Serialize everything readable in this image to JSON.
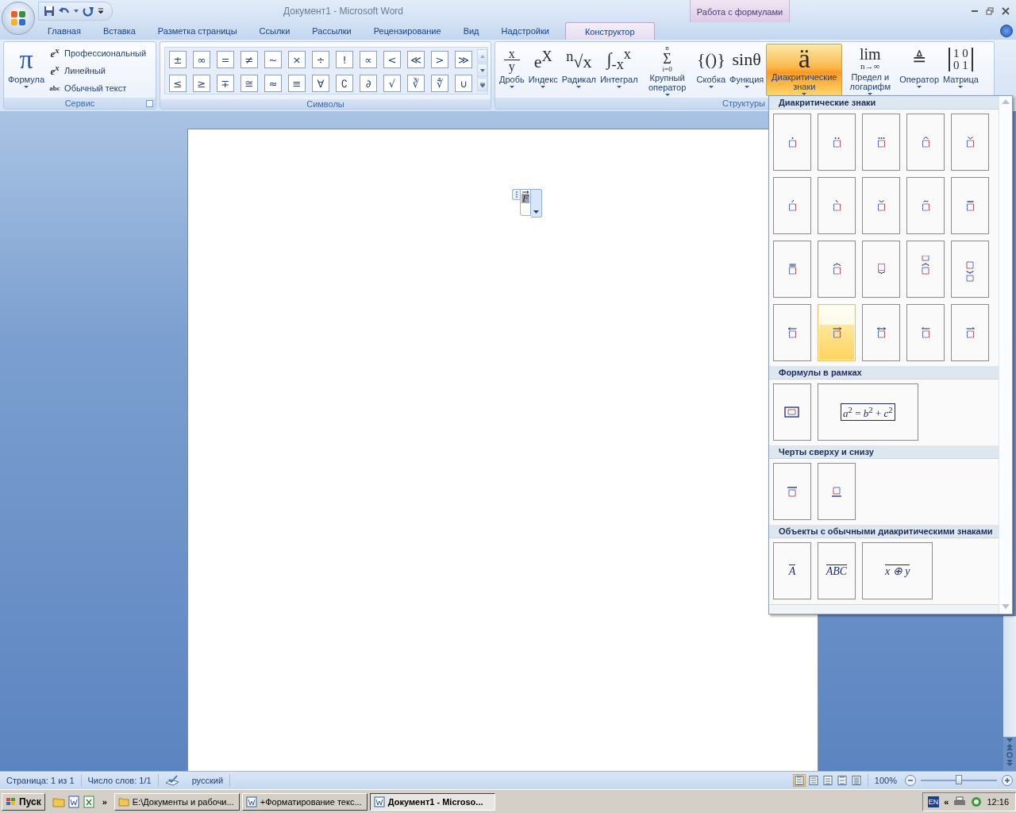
{
  "window": {
    "title": "Документ1 - Microsoft Word",
    "context_title": "Работа с формулами"
  },
  "tabs": [
    {
      "label": "Главная",
      "selected": false
    },
    {
      "label": "Вставка",
      "selected": false
    },
    {
      "label": "Разметка страницы",
      "selected": false
    },
    {
      "label": "Ссылки",
      "selected": false
    },
    {
      "label": "Рассылки",
      "selected": false
    },
    {
      "label": "Рецензирование",
      "selected": false
    },
    {
      "label": "Вид",
      "selected": false
    },
    {
      "label": "Надстройки",
      "selected": false
    },
    {
      "label": "Конструктор",
      "selected": true
    }
  ],
  "service_group": {
    "label": "Сервис",
    "formula_button": {
      "glyph": "π",
      "label": "Формула"
    },
    "options": [
      {
        "glyph": "e$^{x}$",
        "label": "Профессиональный"
      },
      {
        "glyph": "e$^{x}$",
        "label": "Линейный"
      },
      {
        "glyph": "abc",
        "label": "Обычный текст"
      }
    ]
  },
  "symbols_group": {
    "label": "Символы",
    "symbols": [
      "±",
      "∞",
      "=",
      "≠",
      "~",
      "×",
      "÷",
      "!",
      "∝",
      "<",
      "≪",
      ">",
      "≫",
      "≤",
      "≥",
      "∓",
      "≅",
      "≈",
      "≡",
      "∀",
      "∁",
      "∂",
      "√",
      "∛",
      "∜",
      "∪"
    ]
  },
  "structures_group": {
    "label": "Структуры",
    "items": [
      {
        "kind": "fraction",
        "glyph": [
          "x",
          "y"
        ],
        "label": "Дробь",
        "selected": false
      },
      {
        "kind": "inline",
        "glyph": [
          "e$^{X}$"
        ],
        "label": "Индекс",
        "selected": false
      },
      {
        "kind": "inline",
        "glyph": [
          "$^{n}$√x"
        ],
        "label": "Радикал",
        "selected": false
      },
      {
        "kind": "inline",
        "glyph": [
          "∫$_{-x}$$^{x}$"
        ],
        "label": "Интеграл",
        "selected": false
      },
      {
        "kind": "stack",
        "glyph": [
          "n",
          "Σ",
          "i=0"
        ],
        "label": "Крупный оператор",
        "selected": false
      },
      {
        "kind": "inline",
        "glyph": [
          "{()}"
        ],
        "label": "Скобка",
        "selected": false
      },
      {
        "kind": "inline",
        "glyph": [
          "sinθ"
        ],
        "label": "Функция",
        "selected": false
      },
      {
        "kind": "inline",
        "glyph": [
          "ä"
        ],
        "label": "Диакритические знаки",
        "selected": true
      },
      {
        "kind": "stack",
        "glyph": [
          "lim",
          "n→∞"
        ],
        "label": "Предел и логарифм",
        "selected": false
      },
      {
        "kind": "inline",
        "glyph": [
          "≜"
        ],
        "label": "Оператор",
        "selected": false
      },
      {
        "kind": "matrix",
        "glyph": [
          "1 0",
          "0 1"
        ],
        "label": "Матрица",
        "selected": false
      }
    ]
  },
  "gallery": {
    "sections": [
      {
        "title": "Диакритические знаки",
        "items": [
          {
            "kind": "dot",
            "selected": false
          },
          {
            "kind": "ddot",
            "selected": false
          },
          {
            "kind": "tdot",
            "selected": false
          },
          {
            "kind": "hat",
            "selected": false
          },
          {
            "kind": "check",
            "selected": false
          },
          {
            "kind": "acute",
            "selected": false
          },
          {
            "kind": "grave",
            "selected": false
          },
          {
            "kind": "breve",
            "selected": false
          },
          {
            "kind": "tilde",
            "selected": false
          },
          {
            "kind": "bar",
            "selected": false
          },
          {
            "kind": "dbar",
            "selected": false
          },
          {
            "kind": "obrace",
            "selected": false
          },
          {
            "kind": "ubrace",
            "selected": false
          },
          {
            "kind": "obracegroup",
            "selected": false
          },
          {
            "kind": "ubracegroup",
            "selected": false
          },
          {
            "kind": "larrow",
            "selected": false
          },
          {
            "kind": "rarrow",
            "selected": true
          },
          {
            "kind": "lrarrow",
            "selected": false
          },
          {
            "kind": "lharpoon",
            "selected": false
          },
          {
            "kind": "rharpoon",
            "selected": false
          }
        ]
      },
      {
        "title": "Формулы в рамках",
        "items": [
          {
            "kind": "box",
            "selected": false
          },
          {
            "kind": "boxedformula",
            "text": "*a*$^{2}$ = *b*$^{2}$ + *c*$^{2}$",
            "selected": false
          }
        ]
      },
      {
        "title": "Черты сверху и снизу",
        "items": [
          {
            "kind": "overbar",
            "selected": false
          },
          {
            "kind": "underbar",
            "selected": false
          }
        ]
      },
      {
        "title": "Объекты с обычными диакритическими знаками",
        "items": [
          {
            "kind": "textbar",
            "text": "A",
            "selected": false
          },
          {
            "kind": "textbar",
            "text": "ABC",
            "selected": false
          },
          {
            "kind": "textbar",
            "text": "x ⊕ y",
            "selected": false
          }
        ]
      }
    ]
  },
  "document": {
    "equation": {
      "text": "F"
    }
  },
  "status_bar": {
    "page": "Страница: 1 из 1",
    "words": "Число слов: 1/1",
    "language": "русский",
    "views": [
      {
        "kind": "print",
        "selected": true
      },
      {
        "kind": "reading",
        "selected": false
      },
      {
        "kind": "web",
        "selected": false
      },
      {
        "kind": "outline",
        "selected": false
      },
      {
        "kind": "draft",
        "selected": false
      }
    ],
    "zoom": "100%",
    "zoom_slider": {
      "level": 0.5
    }
  },
  "taskbar": {
    "start": "Пуск",
    "more": "»",
    "tasks": [
      {
        "label": "E:\\Документы и рабочи...",
        "kind": "folder",
        "selected": false
      },
      {
        "label": "+Форматирование текс...",
        "kind": "word",
        "selected": false
      },
      {
        "label": "Документ1 - Microso...",
        "kind": "word",
        "selected": true
      }
    ],
    "tray": {
      "language": "EN",
      "expand": "«",
      "time": "12:16"
    }
  }
}
